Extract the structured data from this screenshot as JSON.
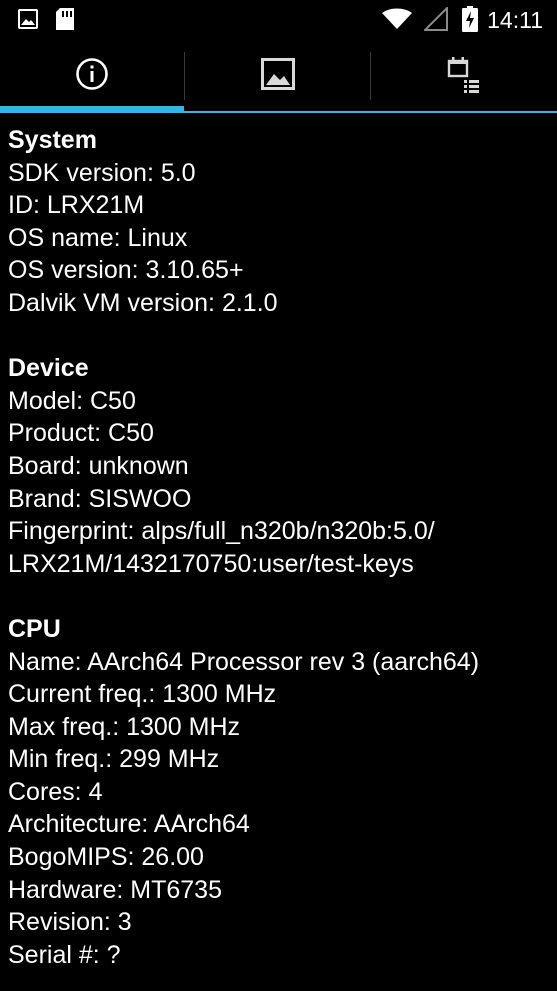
{
  "status_bar": {
    "time": "14:11",
    "left_icons": [
      "image-notification-icon",
      "sd-card-icon"
    ],
    "right_icons": [
      "wifi-icon",
      "signal-icon",
      "battery-charging-icon"
    ]
  },
  "tabs": [
    {
      "icon": "info-icon",
      "active": true
    },
    {
      "icon": "image-icon",
      "active": false
    },
    {
      "icon": "calendar-list-icon",
      "active": false
    }
  ],
  "colors": {
    "accent": "#33b5e5",
    "background": "#000000",
    "text": "#ffffff"
  },
  "sections": {
    "system": {
      "title": "System",
      "lines": [
        "SDK version: 5.0",
        "ID: LRX21M",
        "OS name: Linux",
        "OS version: 3.10.65+",
        "Dalvik VM version: 2.1.0"
      ]
    },
    "device": {
      "title": "Device",
      "lines": [
        "Model: C50",
        "Product: C50",
        "Board: unknown",
        "Brand: SISWOO",
        "Fingerprint: alps/full_n320b/n320b:5.0/",
        "LRX21M/1432170750:user/test-keys"
      ]
    },
    "cpu": {
      "title": "CPU",
      "lines": [
        "Name: AArch64 Processor rev 3 (aarch64)",
        "Current freq.: 1300 MHz",
        "Max freq.: 1300 MHz",
        "Min freq.: 299 MHz",
        "Cores: 4",
        "Architecture: AArch64",
        "BogoMIPS: 26.00",
        "Hardware: MT6735",
        "Revision: 3",
        "Serial #: ?"
      ]
    }
  }
}
